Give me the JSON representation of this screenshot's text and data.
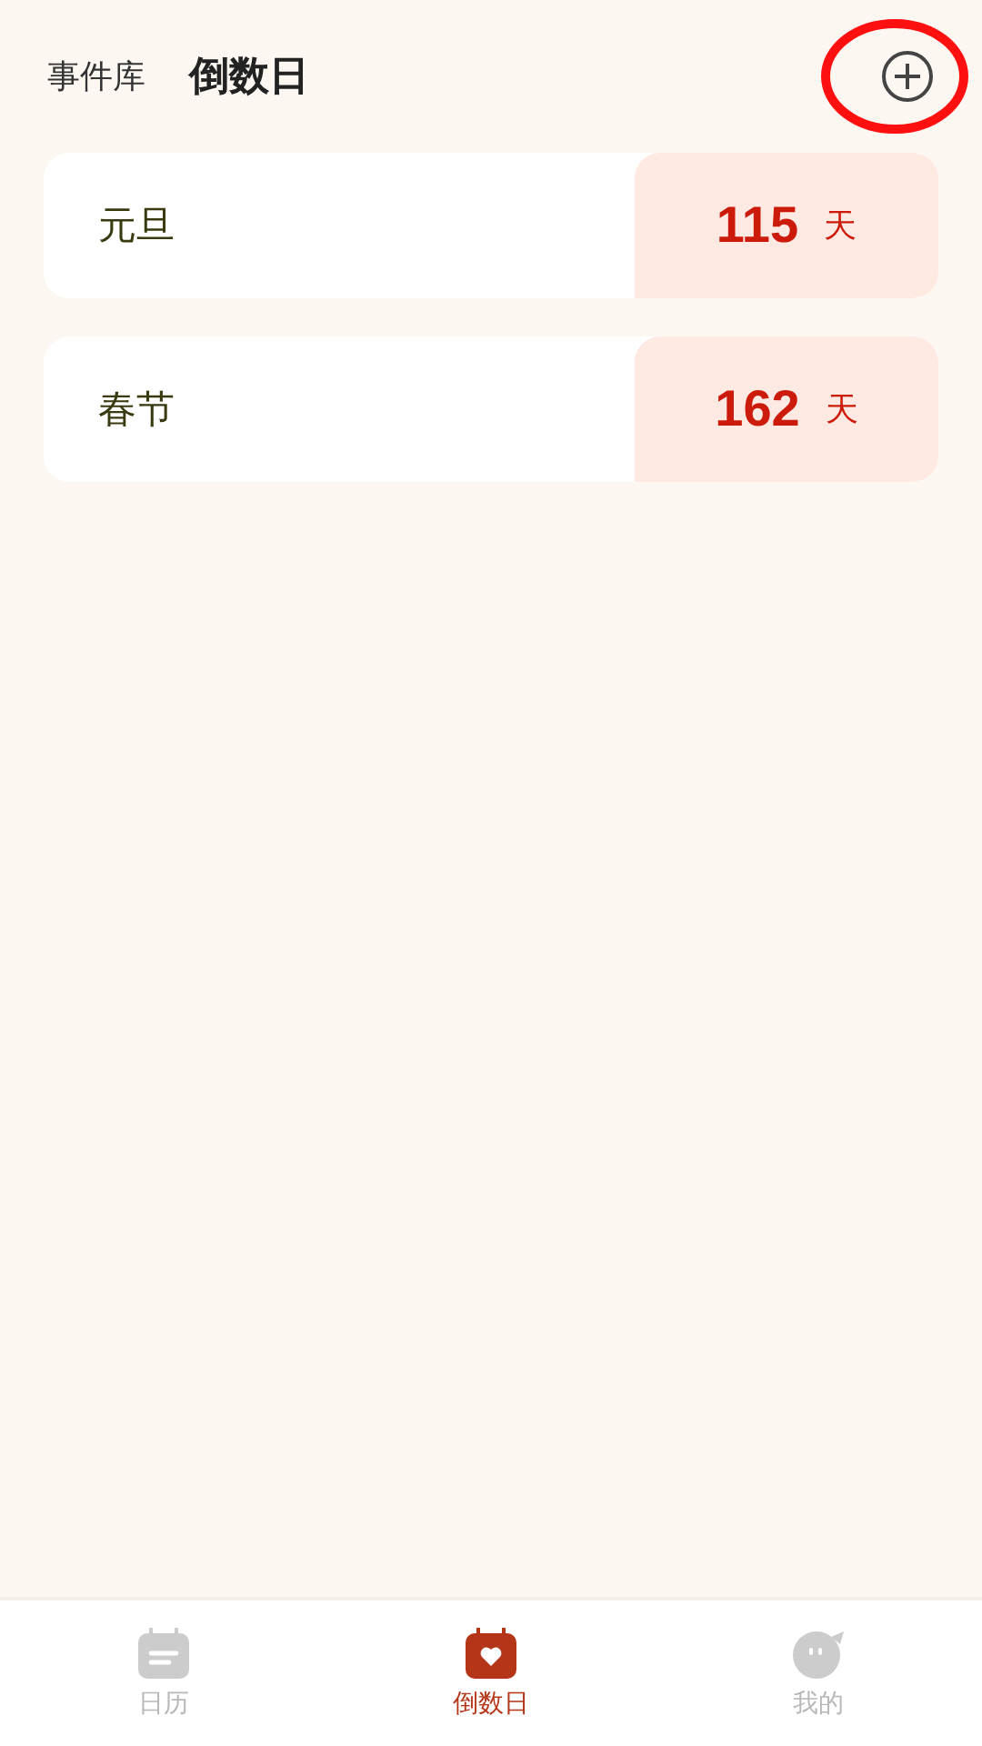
{
  "header_tabs": [
    {
      "label": "事件库",
      "selected": false
    },
    {
      "label": "倒数日",
      "selected": true
    }
  ],
  "add_button": {
    "highlighted": true
  },
  "events": [
    {
      "name": "元旦",
      "days": "115",
      "unit": "天"
    },
    {
      "name": "春节",
      "days": "162",
      "unit": "天"
    }
  ],
  "bottom_nav": [
    {
      "label": "日历",
      "kind": "calendar",
      "selected": false
    },
    {
      "label": "倒数日",
      "kind": "countdown",
      "selected": true
    },
    {
      "label": "我的",
      "kind": "profile",
      "selected": false
    }
  ]
}
